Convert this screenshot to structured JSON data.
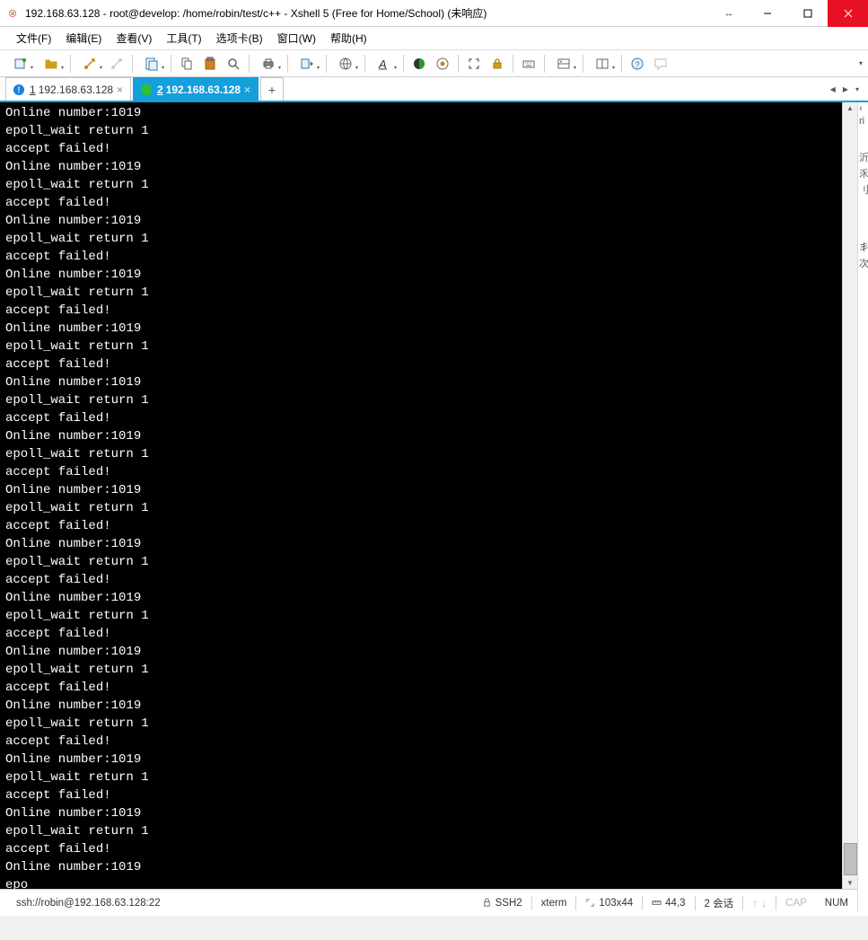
{
  "title": "192.168.63.128 - root@develop: /home/robin/test/c++ - Xshell 5 (Free for Home/School) (未响应)",
  "menu": {
    "file": "文件(F)",
    "edit": "编辑(E)",
    "view": "查看(V)",
    "tools": "工具(T)",
    "tabs": "选项卡(B)",
    "window": "窗口(W)",
    "help": "帮助(H)"
  },
  "tabs": [
    {
      "index": "1",
      "label": "192.168.63.128",
      "active": false
    },
    {
      "index": "2",
      "label": "192.168.63.128",
      "active": true
    }
  ],
  "tab_add": "+",
  "terminal_lines": [
    "Online number:1019",
    "epoll_wait return 1",
    "accept failed!",
    "Online number:1019",
    "epoll_wait return 1",
    "accept failed!",
    "Online number:1019",
    "epoll_wait return 1",
    "accept failed!",
    "Online number:1019",
    "epoll_wait return 1",
    "accept failed!",
    "Online number:1019",
    "epoll_wait return 1",
    "accept failed!",
    "Online number:1019",
    "epoll_wait return 1",
    "accept failed!",
    "Online number:1019",
    "epoll_wait return 1",
    "accept failed!",
    "Online number:1019",
    "epoll_wait return 1",
    "accept failed!",
    "Online number:1019",
    "epoll_wait return 1",
    "accept failed!",
    "Online number:1019",
    "epoll_wait return 1",
    "accept failed!",
    "Online number:1019",
    "epoll_wait return 1",
    "accept failed!",
    "Online number:1019",
    "epoll_wait return 1",
    "accept failed!",
    "Online number:1019",
    "epoll_wait return 1",
    "accept failed!",
    "Online number:1019",
    "epoll_wait return 1",
    "accept failed!",
    "Online number:1019",
    "epo"
  ],
  "right_sliver": {
    "items": [
      "‹",
      "ri",
      "",
      "",
      "",
      "",
      "",
      "",
      "",
      "",
      "",
      "",
      "",
      "",
      "沂",
      "乑",
      "刂",
      "",
      "",
      "",
      "",
      "",
      "",
      "",
      "",
      "",
      "",
      "",
      "",
      "",
      "",
      "",
      "",
      "",
      "",
      "",
      "",
      "",
      "",
      "",
      "丯",
      "次"
    ]
  },
  "status": {
    "conn": "ssh://robin@192.168.63.128:22",
    "proto": "SSH2",
    "term": "xterm",
    "size": "103x44",
    "pos": "44,3",
    "sessions": "2 会话",
    "cap": "CAP",
    "num": "NUM"
  }
}
